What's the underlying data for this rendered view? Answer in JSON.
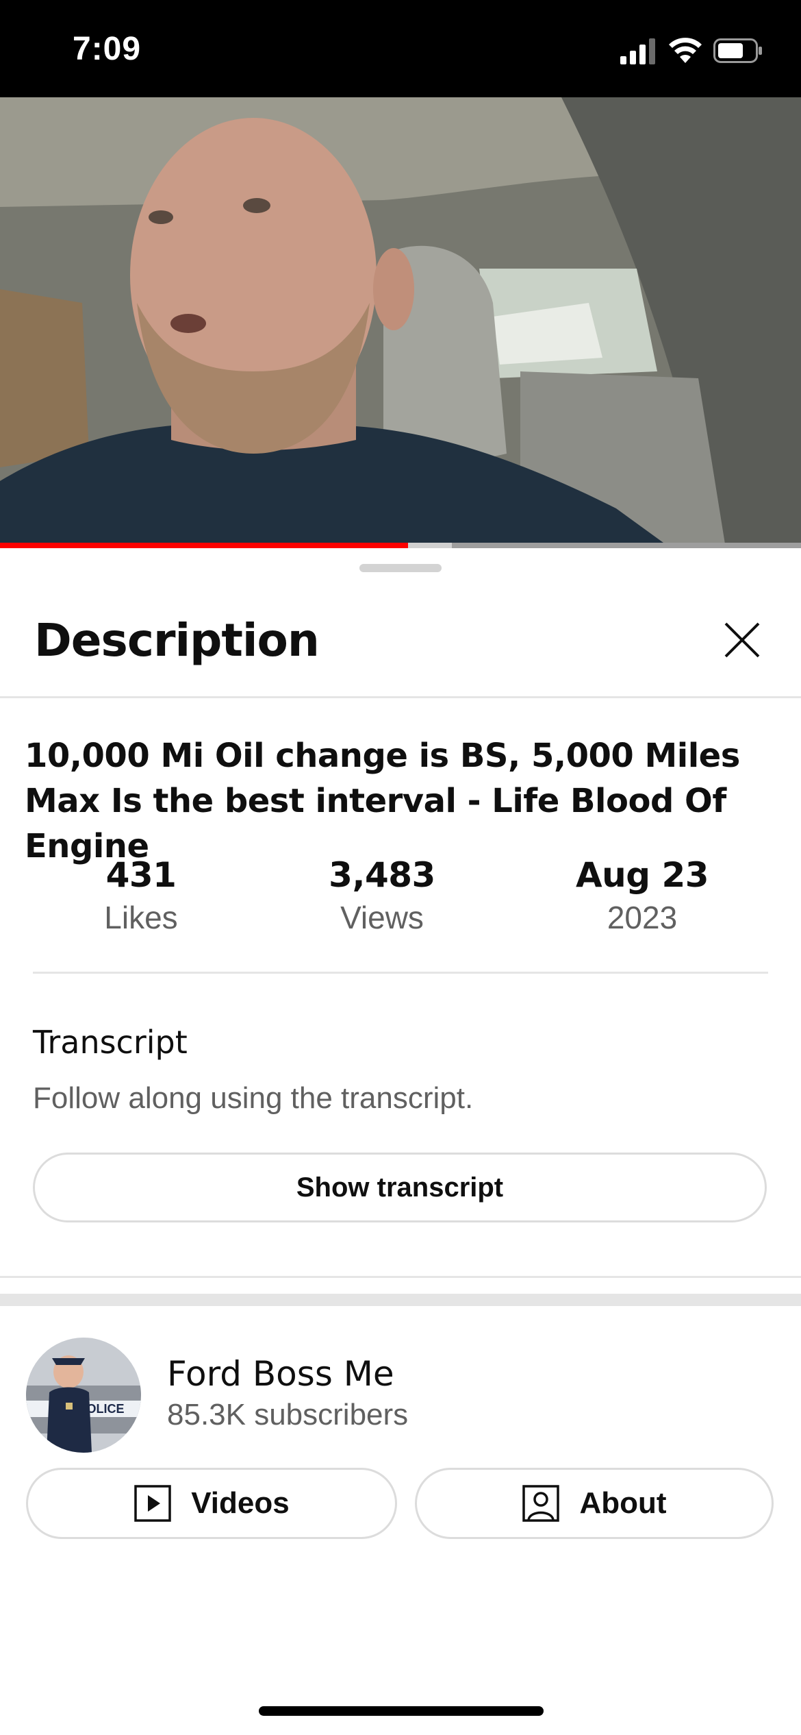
{
  "status_bar": {
    "time": "7:09"
  },
  "video": {
    "progress_fraction": 0.51,
    "buffer_fraction": 0.56
  },
  "sheet": {
    "title": "Description",
    "video_title": "10,000 Mi Oil change is BS, 5,000 Miles Max Is the best interval - Life Blood Of Engine",
    "stats": [
      {
        "value": "431",
        "label": "Likes"
      },
      {
        "value": "3,483",
        "label": "Views"
      },
      {
        "value": "Aug 23",
        "label": "2023"
      }
    ],
    "transcript": {
      "title": "Transcript",
      "subtitle": "Follow along using the transcript.",
      "button_label": "Show transcript"
    },
    "channel": {
      "name": "Ford Boss Me",
      "subscribers": "85.3K subscribers",
      "avatar_text": "POLICE",
      "videos_label": "Videos",
      "about_label": "About"
    }
  },
  "colors": {
    "accent": "#ff0000",
    "text": "#0f0f0f",
    "secondary": "#606060",
    "border": "#dcdcdc"
  },
  "icons": [
    "cellular-signal-icon",
    "wifi-icon",
    "battery-icon",
    "close-icon",
    "play-square-icon",
    "person-square-icon"
  ]
}
